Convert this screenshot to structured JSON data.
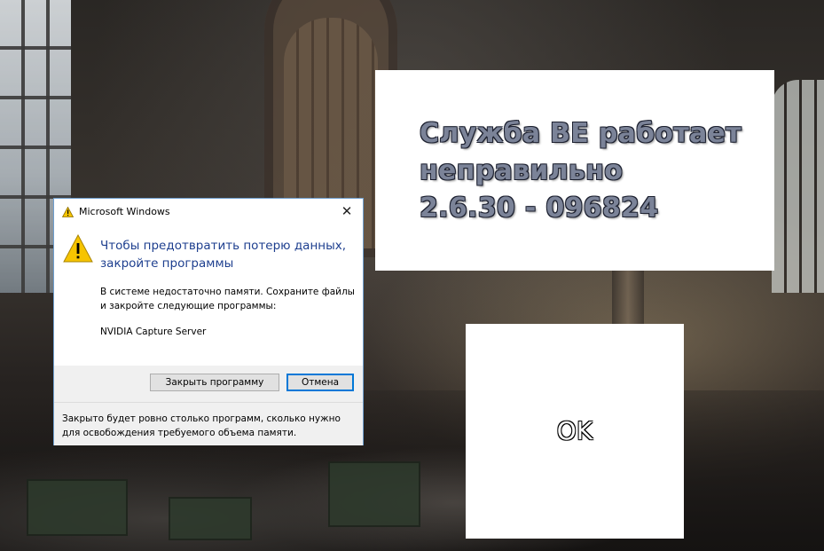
{
  "dialog": {
    "title": "Microsoft Windows",
    "close_glyph": "✕",
    "main_instruction": "Чтобы предотвратить потерю данных, закройте программы",
    "body": "В системе недостаточно памяти. Сохраните файлы и закройте следующие программы:",
    "program": "NVIDIA Capture Server",
    "close_program_button": "Закрыть программу",
    "cancel_button": "Отмена",
    "footer": "Закрыто будет ровно столько программ, сколько нужно для освобождения требуемого объема памяти.",
    "icons": {
      "title": "warning-icon",
      "main": "warning-icon"
    },
    "colors": {
      "main_instruction": "#1e3f8f",
      "focus_border": "#0078d7"
    }
  },
  "error_panel": {
    "lines": [
      "Служба BE работает",
      "неправильно",
      "2.6.30 - 096824"
    ],
    "text_color": "#7b8398"
  },
  "ok_panel": {
    "label": "OK"
  }
}
